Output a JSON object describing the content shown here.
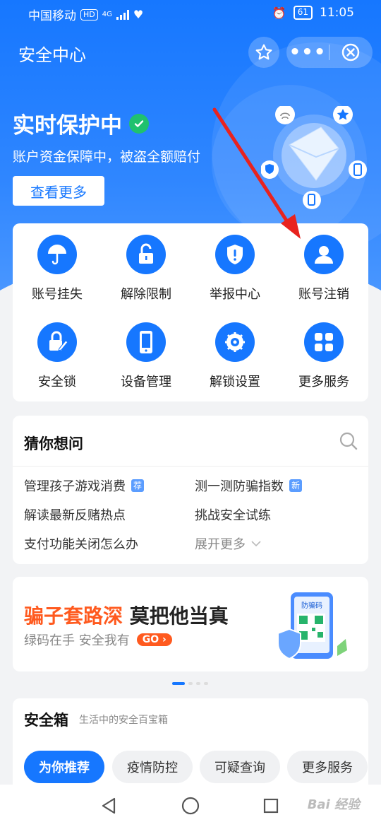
{
  "status": {
    "carrier": "中国移动",
    "hd": "HD",
    "net": "4G",
    "battery": "61",
    "time": "11:05"
  },
  "header": {
    "title": "安全中心",
    "more_glyph": "•••"
  },
  "protection": {
    "title": "实时保护中",
    "subtitle": "账户资金保障中，被盗全额赔付",
    "button": "查看更多"
  },
  "services": [
    {
      "label": "账号挂失",
      "icon": "umbrella-icon"
    },
    {
      "label": "解除限制",
      "icon": "unlock-icon"
    },
    {
      "label": "举报中心",
      "icon": "shield-alert-icon"
    },
    {
      "label": "账号注销",
      "icon": "user-icon"
    },
    {
      "label": "安全锁",
      "icon": "lock-edit-icon"
    },
    {
      "label": "设备管理",
      "icon": "phone-icon"
    },
    {
      "label": "解锁设置",
      "icon": "key-gear-icon"
    },
    {
      "label": "更多服务",
      "icon": "grid-icon"
    }
  ],
  "guess": {
    "title": "猜你想问",
    "questions": [
      {
        "text": "管理孩子游戏消费",
        "tag": "荐"
      },
      {
        "text": "测一测防骗指数",
        "tag": "新"
      },
      {
        "text": "解读最新反赌热点",
        "tag": ""
      },
      {
        "text": "挑战安全试练",
        "tag": ""
      },
      {
        "text": "支付功能关闭怎么办",
        "tag": ""
      }
    ],
    "expand": "展开更多"
  },
  "banner": {
    "headline_red": "骗子套路深",
    "headline_dark": "莫把他当真",
    "sub": "绿码在手 安全我有",
    "go": "GO",
    "pic_label": "防骗码"
  },
  "safebox": {
    "title": "安全箱",
    "subtitle": "生活中的安全百宝箱",
    "chips": [
      "为你推荐",
      "疫情防控",
      "可疑查询",
      "更多服务"
    ]
  },
  "watermark": "Bai 经验",
  "colors": {
    "brand": "#1677ff",
    "accent": "#ff5a1f",
    "success": "#20c16e",
    "annotation": "#e8231f"
  }
}
